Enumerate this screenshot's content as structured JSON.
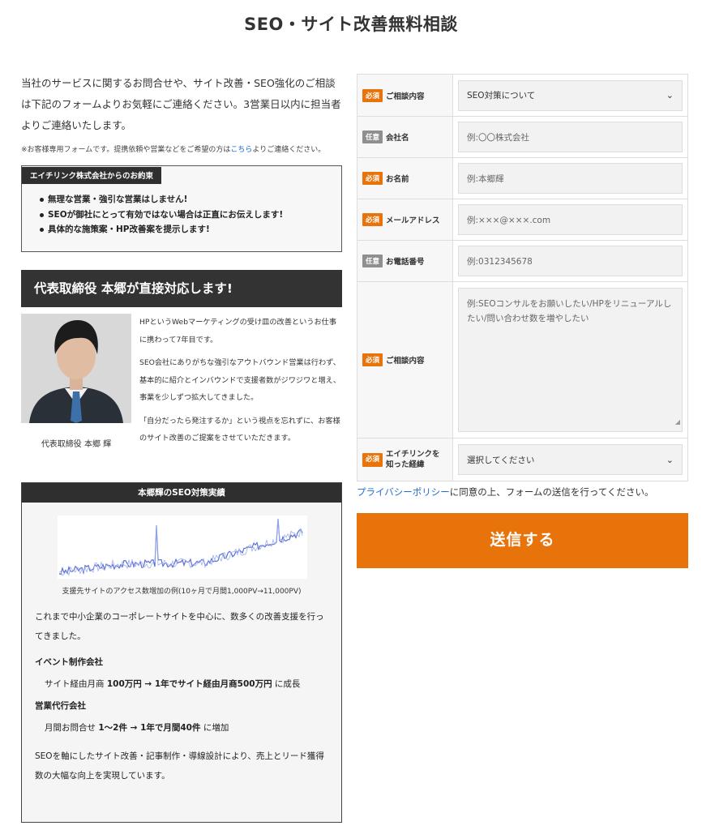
{
  "page_title": "SEO・サイト改善無料相談",
  "intro": "当社のサービスに関するお問合せや、サイト改善・SEO強化のご相談は下記のフォームよりお気軽にご連絡ください。3営業日以内に担当者よりご連絡いたします。",
  "note": {
    "before": "※お客様専用フォームです。提携依頼や営業などをご希望の方は",
    "link": "こちら",
    "after": "よりご連絡ください。"
  },
  "promise": {
    "title": "エイチリンク株式会社からのお約束",
    "items": [
      "無理な営業・強引な営業はしません!",
      "SEOが御社にとって有効ではない場合は正直にお伝えします!",
      "具体的な施策案・HP改善案を提示します!"
    ]
  },
  "ceo": {
    "banner": "代表取締役 本郷が直接対応します!",
    "caption": "代表取締役 本郷 輝",
    "bio": [
      "HPというWebマーケティングの受け皿の改善というお仕事に携わって7年目です。",
      "SEO会社にありがちな強引なアウトバウンド営業は行わず、基本的に紹介とインバウンドで支援者数がジワジワと増え、事業を少しずつ拡大してきました。",
      "「自分だったら発注するか」という視点を忘れずに、お客様のサイト改善のご提案をさせていただきます。"
    ]
  },
  "results": {
    "title": "本郷輝のSEO対策実績",
    "chart_caption": "支援先サイトのアクセス数増加の例(10ヶ月で月間1,000PV→11,000PV)",
    "text1": "これまで中小企業のコーポレートサイトを中心に、数多くの改善支援を行ってきました。",
    "case1_title": "イベント制作会社",
    "case1_a": "サイト経由月商 ",
    "case1_b": "100万円 → 1年でサイト経由月商500万円",
    "case1_c": " に成長",
    "case2_title": "営業代行会社",
    "case2_a": "月間お問合せ ",
    "case2_b": "1〜2件 → 1年で月間40件",
    "case2_c": " に増加",
    "text2": "SEOを軸にしたサイト改善・記事制作・導線設計により、売上とリード獲得数の大幅な向上を実現しています。"
  },
  "form": {
    "required_label": "必須",
    "optional_label": "任意",
    "fields": [
      {
        "label": "ご相談内容",
        "value": "SEO対策について"
      },
      {
        "label": "会社名",
        "placeholder": "例:〇〇株式会社"
      },
      {
        "label": "お名前",
        "placeholder": "例:本郷輝"
      },
      {
        "label": "メールアドレス",
        "placeholder": "例:×××@×××.com"
      },
      {
        "label": "お電話番号",
        "placeholder": "例:0312345678"
      },
      {
        "label": "ご相談内容",
        "placeholder": "例:SEOコンサルをお願いしたい/HPをリニューアルしたい/問い合わせ数を増やしたい"
      },
      {
        "label": "エイチリンクを知った経緯",
        "value": "選択してください"
      }
    ],
    "privacy_link": "プライバシーポリシー",
    "privacy_text": "に同意の上、フォームの送信を行ってください。",
    "submit": "送信する"
  },
  "colors": {
    "accent": "#e8730a",
    "dark": "#2f2f2f",
    "link": "#1e6bd6",
    "chart_line": "#5a6fd6"
  }
}
